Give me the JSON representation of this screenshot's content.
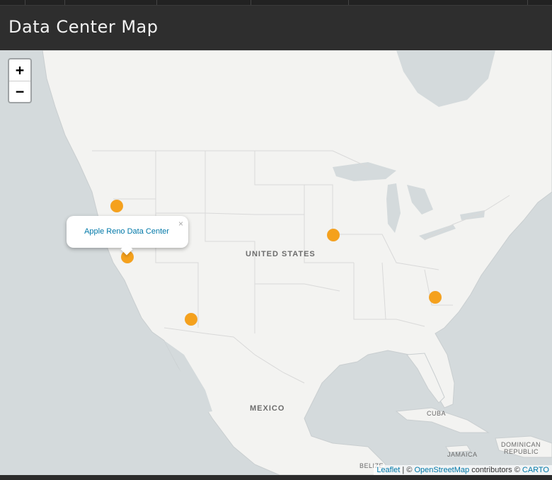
{
  "header": {
    "title": "Data Center Map"
  },
  "zoom": {
    "in_label": "+",
    "out_label": "−"
  },
  "popup": {
    "text": "Apple Reno Data Center",
    "close_label": "×"
  },
  "map_labels": {
    "us": "UNITED STATES",
    "mexico": "MEXICO",
    "cuba": "CUBA",
    "belize": "BELIZE",
    "jamaica": "JAMAICA",
    "dominican_1": "DOMINICAN",
    "dominican_2": "REPUBLIC"
  },
  "attribution": {
    "leaflet": "Leaflet",
    "sep": " | © ",
    "osm": "OpenStreetMap",
    "contrib": " contributors © ",
    "carto": "CARTO"
  },
  "markers": [
    {
      "name": "Apple Reno Data Center"
    },
    {
      "name": "marker-oregon"
    },
    {
      "name": "marker-iowa"
    },
    {
      "name": "marker-arizona"
    },
    {
      "name": "marker-north-carolina"
    }
  ],
  "colors": {
    "marker": "#f5a11c",
    "water": "#d4dadc",
    "land": "#f2f2f0",
    "link": "#0078a8"
  }
}
